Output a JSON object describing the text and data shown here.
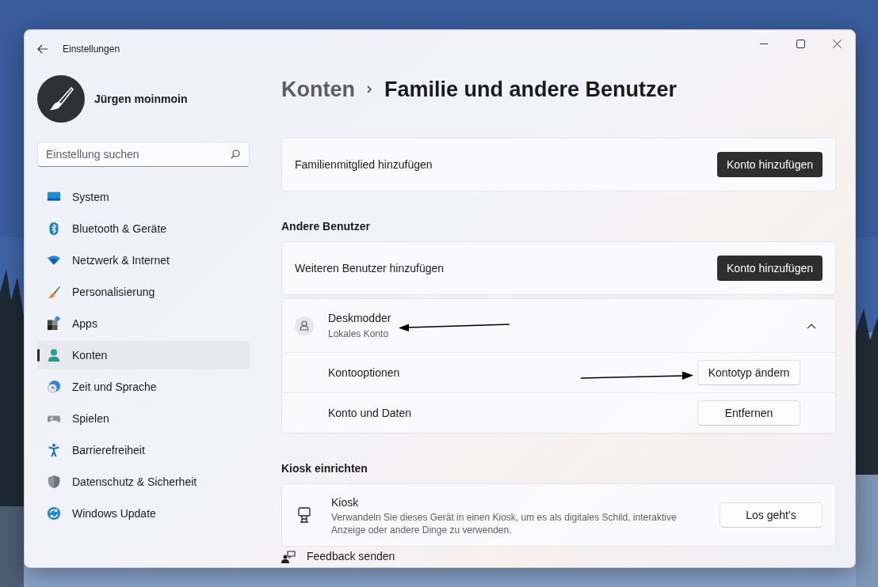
{
  "window": {
    "title": "Einstellungen"
  },
  "profile": {
    "name": "Jürgen moinmoin"
  },
  "search": {
    "placeholder": "Einstellung suchen"
  },
  "sidebar": {
    "items": [
      {
        "label": "System",
        "selected": false
      },
      {
        "label": "Bluetooth & Geräte",
        "selected": false
      },
      {
        "label": "Netzwerk & Internet",
        "selected": false
      },
      {
        "label": "Personalisierung",
        "selected": false
      },
      {
        "label": "Apps",
        "selected": false
      },
      {
        "label": "Konten",
        "selected": true
      },
      {
        "label": "Zeit und Sprache",
        "selected": false
      },
      {
        "label": "Spielen",
        "selected": false
      },
      {
        "label": "Barrierefreiheit",
        "selected": false
      },
      {
        "label": "Datenschutz & Sicherheit",
        "selected": false
      },
      {
        "label": "Windows Update",
        "selected": false
      }
    ]
  },
  "breadcrumb": {
    "parent": "Konten",
    "current": "Familie und andere Benutzer"
  },
  "family": {
    "label": "Familienmitglied hinzufügen",
    "button": "Konto hinzufügen"
  },
  "other_users": {
    "title": "Andere Benutzer",
    "add": {
      "label": "Weiteren Benutzer hinzufügen",
      "button": "Konto hinzufügen"
    },
    "user": {
      "name": "Deskmodder",
      "subtitle": "Lokales Konto",
      "expanded": true,
      "options": [
        {
          "label": "Kontooptionen",
          "button": "Kontotyp ändern"
        },
        {
          "label": "Konto und Daten",
          "button": "Entfernen"
        }
      ]
    }
  },
  "kiosk": {
    "title": "Kiosk einrichten",
    "item": {
      "title": "Kiosk",
      "description": "Verwandeln Sie dieses Gerät in einen Kiosk, um es als digitales Schild, interaktive Anzeige oder andere Dinge zu verwenden.",
      "button": "Los geht's"
    }
  },
  "feedback": {
    "label": "Feedback senden"
  }
}
